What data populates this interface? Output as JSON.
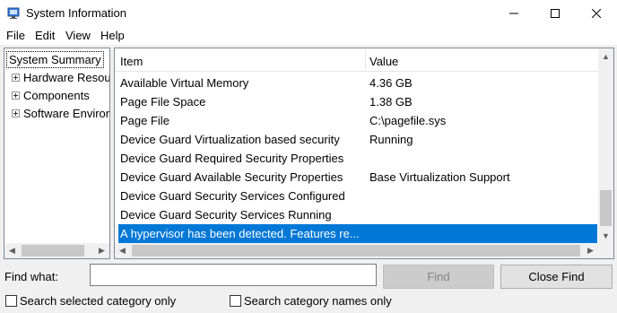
{
  "window": {
    "title": "System Information",
    "icon": "system-information-icon"
  },
  "menu": [
    "File",
    "Edit",
    "View",
    "Help"
  ],
  "tree": {
    "selected": "System Summary",
    "children": [
      "Hardware Resources",
      "Components",
      "Software Environment"
    ]
  },
  "list": {
    "columns": [
      "Item",
      "Value"
    ],
    "rows": [
      {
        "item": "Available Virtual Memory",
        "value": "4.36 GB"
      },
      {
        "item": "Page File Space",
        "value": "1.38 GB"
      },
      {
        "item": "Page File",
        "value": "C:\\pagefile.sys"
      },
      {
        "item": "Device Guard Virtualization based security",
        "value": "Running"
      },
      {
        "item": "Device Guard Required Security Properties",
        "value": ""
      },
      {
        "item": "Device Guard Available Security Properties",
        "value": "Base Virtualization Support"
      },
      {
        "item": "Device Guard Security Services Configured",
        "value": ""
      },
      {
        "item": "Device Guard Security Services Running",
        "value": ""
      },
      {
        "item": "A hypervisor has been detected. Features re...",
        "value": ""
      }
    ],
    "selected_index": 8
  },
  "find": {
    "label": "Find what:",
    "value": "",
    "find_button": "Find",
    "close_button": "Close Find",
    "search_selected": {
      "label": "Search selected category only",
      "checked": false
    },
    "search_names": {
      "label": "Search category names only",
      "checked": false
    }
  },
  "colors": {
    "selection": "#0078d7",
    "window_bg": "#f0f0f0"
  }
}
